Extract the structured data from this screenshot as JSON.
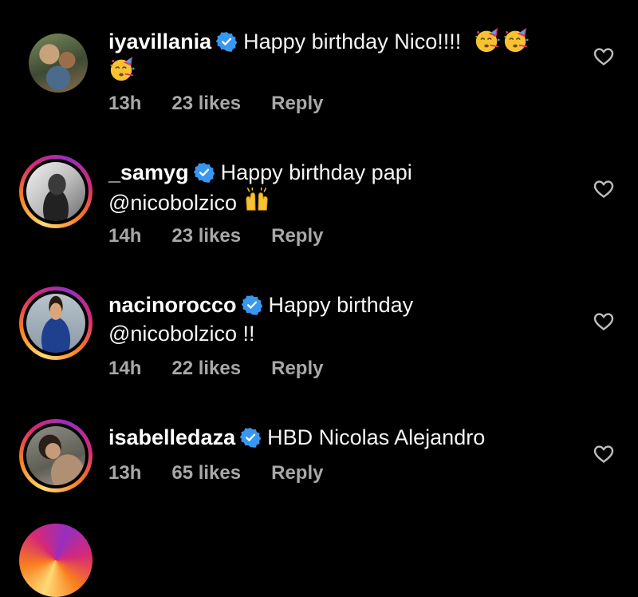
{
  "comments": [
    {
      "username": "iyavillania",
      "text_line1": "Happy birthday Nico!!!!",
      "text_line2": "",
      "emoji_line1": [
        "partying-face-emoji",
        "partying-face-emoji"
      ],
      "emoji_line2": [
        "partying-face-emoji"
      ],
      "time": "13h",
      "likes": "23 likes",
      "reply": "Reply",
      "story_ring": false
    },
    {
      "username": "_samyg",
      "text_line1": "Happy birthday papi",
      "text_line2": "@nicobolzico",
      "emoji_line2": [
        "raising-hands-emoji"
      ],
      "time": "14h",
      "likes": "23 likes",
      "reply": "Reply",
      "story_ring": true
    },
    {
      "username": "nacinorocco",
      "text_line1": "Happy birthday",
      "text_line2": "@nicobolzico !!",
      "time": "14h",
      "likes": "22 likes",
      "reply": "Reply",
      "story_ring": true
    },
    {
      "username": "isabelledaza",
      "text_line1": "HBD Nicolas Alejandro",
      "text_line2": "",
      "time": "13h",
      "likes": "65 likes",
      "reply": "Reply",
      "story_ring": true
    }
  ],
  "icons": {
    "verified": "verified-badge-icon",
    "like": "heart-outline-icon"
  },
  "colors": {
    "background": "#000000",
    "verified_blue": "#3897f0",
    "meta_gray": "#a8a8a8"
  }
}
